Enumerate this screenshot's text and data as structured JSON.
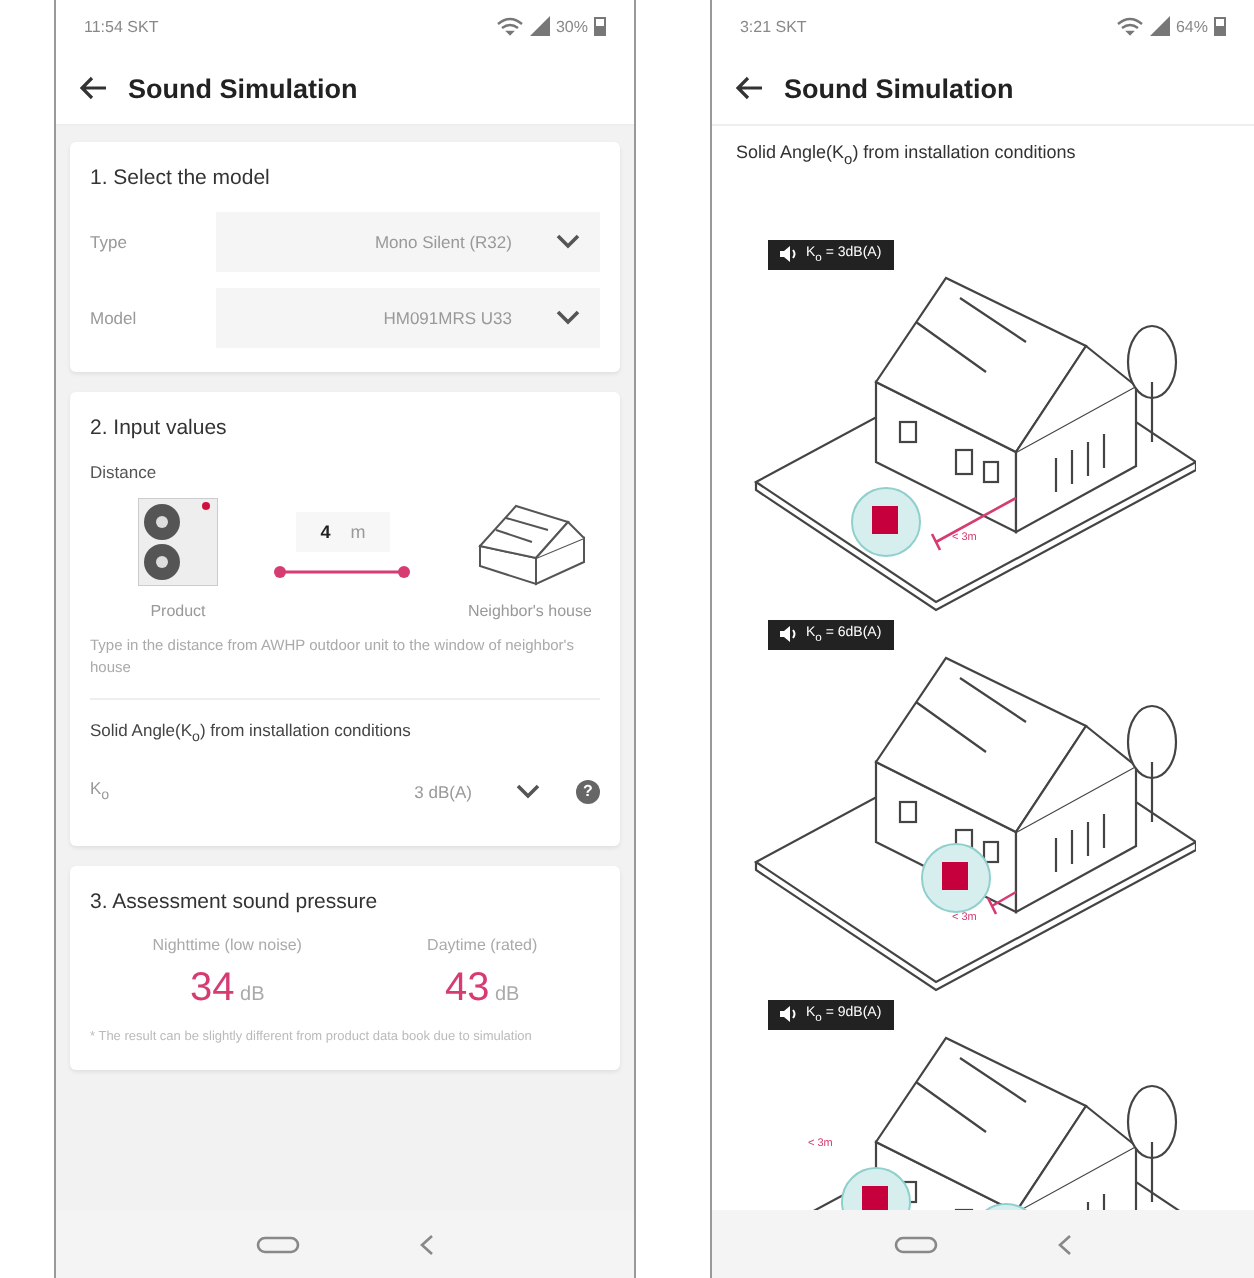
{
  "left_screen": {
    "status_bar": {
      "time": "11:54 SKT",
      "battery": "30%"
    },
    "app_bar": {
      "title": "Sound Simulation"
    },
    "select_model": {
      "title": "1. Select the model",
      "fields": [
        {
          "label": "Type",
          "value": "Mono Silent (R32)"
        },
        {
          "label": "Model",
          "value": "HM091MRS U33"
        }
      ]
    },
    "input_values": {
      "title": "2. Input values",
      "distance_label": "Distance",
      "product_label": "Product",
      "distance_value": "4",
      "distance_unit": "m",
      "house_label": "Neighbor's house",
      "hint": "Type in the distance from AWHP outdoor unit to the window of neighbor's house",
      "solid_angle_title": "Solid Angle(K$_{o}$) from installation conditions",
      "ko_label": "K$_{o}$",
      "ko_value": "3 dB(A)",
      "help": "?"
    },
    "assessment": {
      "title": "3. Assessment sound pressure",
      "results": [
        {
          "label": "Nighttime (low noise)",
          "value": "34",
          "unit": "dB"
        },
        {
          "label": "Daytime (rated)",
          "value": "43",
          "unit": "dB"
        }
      ],
      "note": "* The result can be slightly different from product data book due to simulation"
    }
  },
  "right_screen": {
    "status_bar": {
      "time": "3:21 SKT",
      "battery": "64%"
    },
    "app_bar": {
      "title": "Sound Simulation"
    },
    "heading": "Solid Angle(K$_{o}$) from installation conditions",
    "illustrations": [
      {
        "kind": "single",
        "badge": "K$_{o}$ = 3dB(A)",
        "distance": "< 3m"
      },
      {
        "kind": "wall",
        "badge": "K$_{o}$ = 6dB(A)",
        "distance": "< 3m"
      },
      {
        "kind": "corner",
        "badge": "K$_{o}$ = 9dB(A)",
        "distance": "< 3m"
      }
    ]
  }
}
